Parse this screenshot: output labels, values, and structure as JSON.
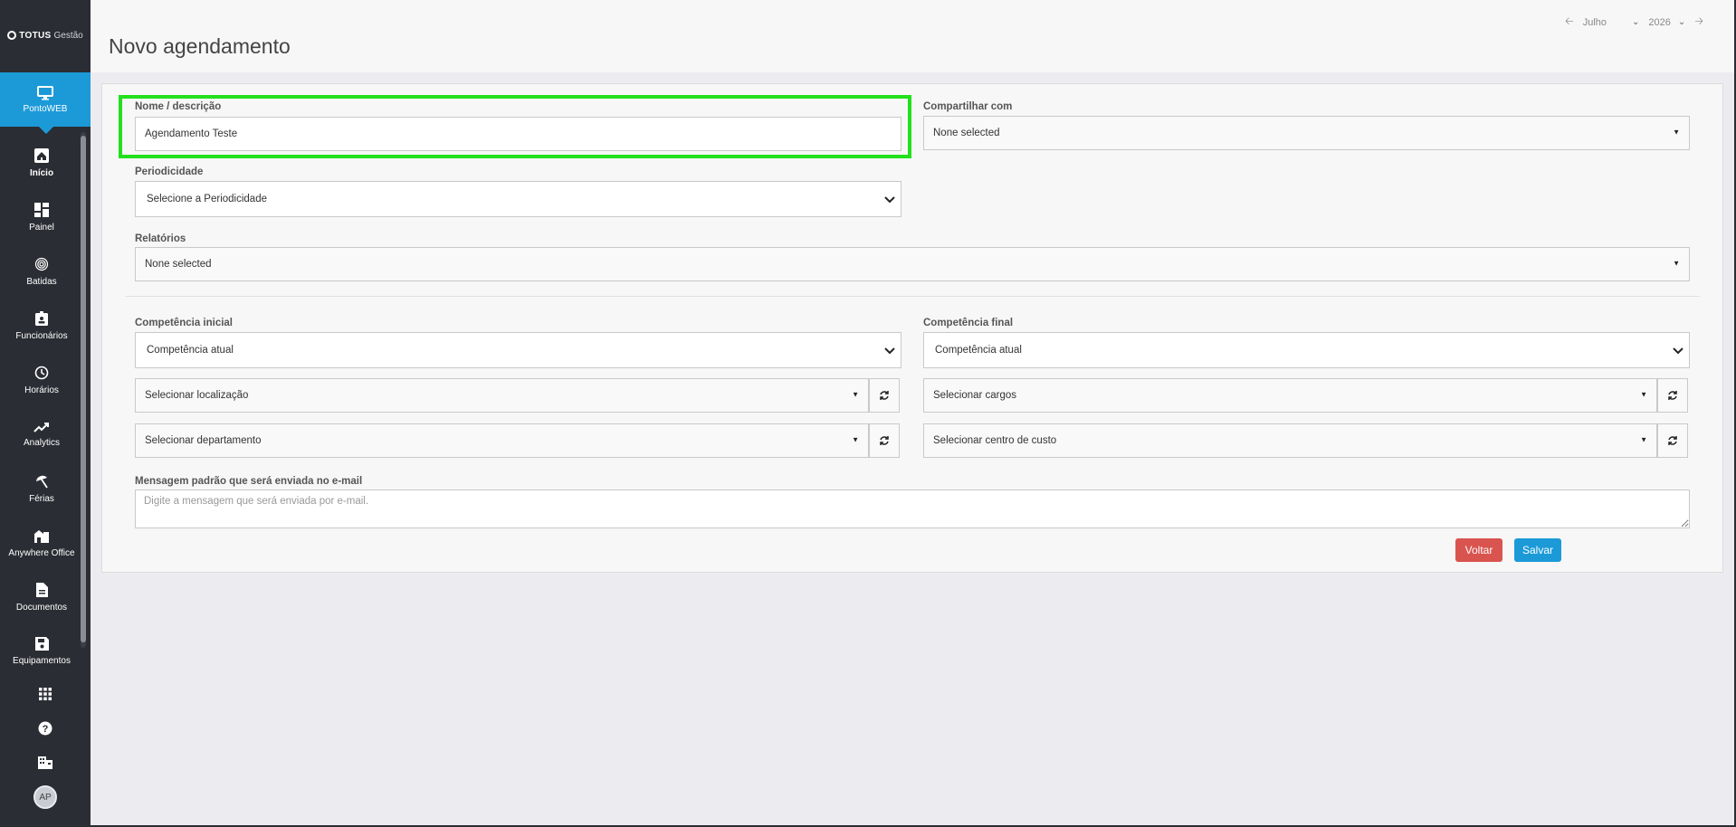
{
  "brand": {
    "name_bold": "TOTUS",
    "name_light": "Gestão"
  },
  "sidebar": {
    "active": {
      "label": "PontoWEB",
      "icon": "monitor-icon"
    },
    "items": [
      {
        "label": "Início",
        "icon": "home-icon"
      },
      {
        "label": "Painel",
        "icon": "dashboard-icon"
      },
      {
        "label": "Batidas",
        "icon": "fingerprint-icon"
      },
      {
        "label": "Funcionários",
        "icon": "badge-icon"
      },
      {
        "label": "Horários",
        "icon": "clock-icon"
      },
      {
        "label": "Analytics",
        "icon": "trending-icon"
      },
      {
        "label": "Férias",
        "icon": "umbrella-icon"
      },
      {
        "label": "Anywhere Office",
        "icon": "building-icon"
      },
      {
        "label": "Documentos",
        "icon": "document-icon"
      },
      {
        "label": "Equipamentos",
        "icon": "save-icon"
      }
    ],
    "bottom": [
      "apps-icon",
      "help-icon",
      "company-icon"
    ],
    "avatar": "AP"
  },
  "header": {
    "title": "Novo agendamento",
    "month": "Julho",
    "year": "2026"
  },
  "form": {
    "nome_label": "Nome / descrição",
    "nome_value": "Agendamento Teste",
    "compartilhar_label": "Compartilhar com",
    "compartilhar_value": "None selected",
    "periodicidade_label": "Periodicidade",
    "periodicidade_value": "Selecione a Periodicidade",
    "relatorios_label": "Relatórios",
    "relatorios_value": "None selected",
    "comp_inicial_label": "Competência inicial",
    "comp_inicial_value": "Competência atual",
    "comp_final_label": "Competência final",
    "comp_final_value": "Competência atual",
    "localizacao": "Selecionar localização",
    "cargos": "Selecionar cargos",
    "departamento": "Selecionar departamento",
    "centro_custo": "Selecionar centro de custo",
    "mensagem_label": "Mensagem padrão que será enviada no e-mail",
    "mensagem_placeholder": "Digite a mensagem que será enviada por e-mail."
  },
  "buttons": {
    "voltar": "Voltar",
    "salvar": "Salvar"
  },
  "colors": {
    "sidebar": "#2b2d34",
    "accent": "#1c9ad8",
    "danger": "#d9534f",
    "highlight": "#22e01b"
  }
}
